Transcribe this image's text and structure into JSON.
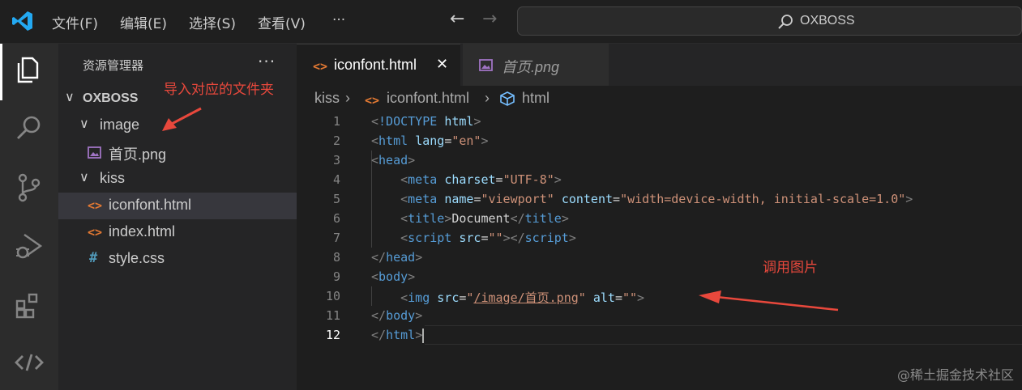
{
  "titlebar": {
    "menu": [
      "文件(F)",
      "编辑(E)",
      "选择(S)",
      "查看(V)",
      "···"
    ],
    "search_text": "OXBOSS"
  },
  "sidebar": {
    "title": "资源管理器",
    "more": "···",
    "root": "OXBOSS",
    "items": [
      {
        "label": "image",
        "type": "folder"
      },
      {
        "label": "首页.png",
        "type": "image-file"
      },
      {
        "label": "kiss",
        "type": "folder"
      },
      {
        "label": "iconfont.html",
        "type": "html-file",
        "selected": true
      },
      {
        "label": "index.html",
        "type": "html-file"
      },
      {
        "label": "style.css",
        "type": "css-file"
      }
    ]
  },
  "annotations": {
    "import_folder": "导入对应的文件夹",
    "call_image": "调用图片"
  },
  "tabs": [
    {
      "label": "iconfont.html",
      "active": true,
      "close": "✕"
    },
    {
      "label": "首页.png",
      "active": false
    }
  ],
  "breadcrumb": [
    "kiss",
    "iconfont.html",
    "html"
  ],
  "editor": {
    "current_line": 12,
    "line_numbers": [
      "1",
      "2",
      "3",
      "4",
      "5",
      "6",
      "7",
      "8",
      "9",
      "10",
      "11",
      "12"
    ]
  },
  "watermark": "@稀土掘金技术社区",
  "colors": {
    "accent_annotation": "#e8483c",
    "html_icon": "#e37933",
    "image_icon": "#a074c4",
    "css_icon": "#519aba",
    "vscode_blue": "#23a9f2"
  }
}
